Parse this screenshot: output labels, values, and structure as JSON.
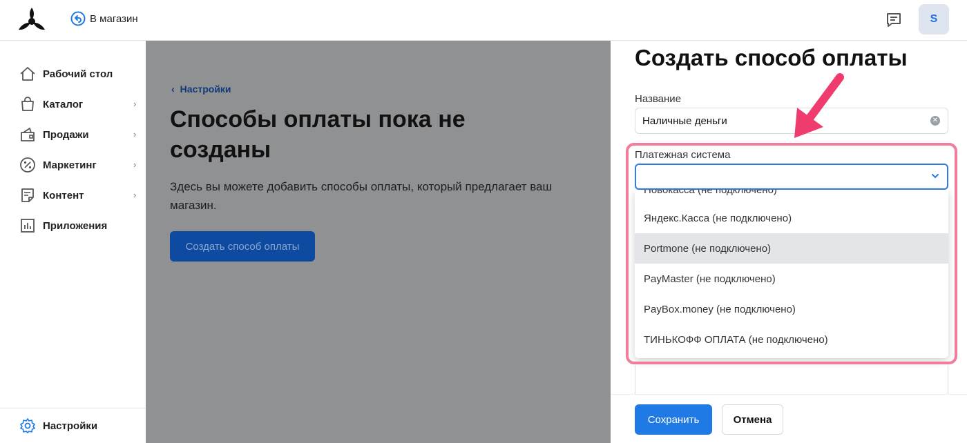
{
  "header": {
    "back_label": "В магазин",
    "avatar_letter": "S"
  },
  "sidebar": {
    "items": [
      {
        "label": "Рабочий стол",
        "icon": "home-icon",
        "has_submenu": false
      },
      {
        "label": "Каталог",
        "icon": "bag-icon",
        "has_submenu": true
      },
      {
        "label": "Продажи",
        "icon": "sales-icon",
        "has_submenu": true
      },
      {
        "label": "Маркетинг",
        "icon": "percent-icon",
        "has_submenu": true
      },
      {
        "label": "Контент",
        "icon": "document-icon",
        "has_submenu": true
      },
      {
        "label": "Приложения",
        "icon": "chart-icon",
        "has_submenu": false
      }
    ],
    "settings_label": "Настройки"
  },
  "main": {
    "breadcrumb": "Настройки",
    "title": "Способы оплаты пока не созданы",
    "description": "Здесь вы можете добавить способы оплаты, который предлагает ваш магазин.",
    "create_button": "Создать способ оплаты"
  },
  "panel": {
    "title": "Создать способ оплаты",
    "name_label": "Название",
    "name_value": "Наличные деньги",
    "payment_system_label": "Платежная система",
    "payment_system_value": "",
    "dropdown": {
      "partial_item": "Новокасса (не подключено)",
      "items": [
        "Яндекс.Касса (не подключено)",
        "Portmone (не подключено)",
        "PayMaster (не подключено)",
        "PayBox.money (не подключено)",
        "ТИНЬКОФФ ОПЛАТА (не подключено)"
      ],
      "highlighted_index": 1
    },
    "save_button": "Сохранить",
    "cancel_button": "Отмена"
  },
  "colors": {
    "accent": "#1f7ae6",
    "overlay": "#909193",
    "annotation": "#ef3b6e"
  }
}
